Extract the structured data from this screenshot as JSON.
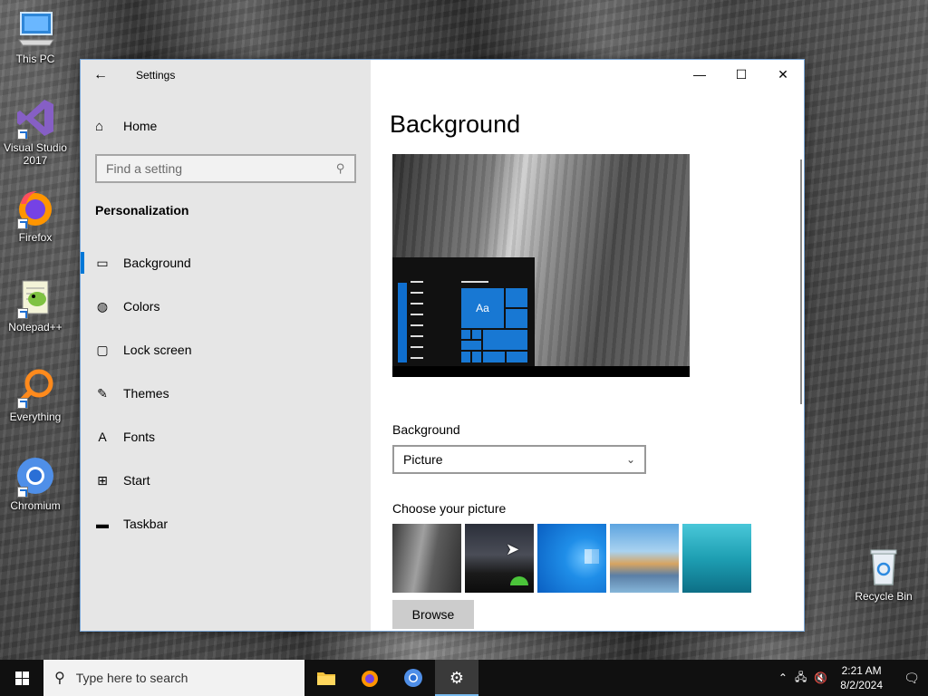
{
  "desktop": {
    "icons": [
      {
        "label": "This PC",
        "icon": "computer-icon"
      },
      {
        "label": "Visual Studio 2017",
        "icon": "visual-studio-icon"
      },
      {
        "label": "Firefox",
        "icon": "firefox-icon"
      },
      {
        "label": "Notepad++",
        "icon": "notepad-plus-plus-icon"
      },
      {
        "label": "Everything",
        "icon": "everything-search-icon"
      },
      {
        "label": "Chromium",
        "icon": "chromium-icon"
      },
      {
        "label": "Recycle Bin",
        "icon": "recycle-bin-icon"
      }
    ]
  },
  "window": {
    "app_title": "Settings",
    "caption": {
      "minimize": "—",
      "maximize": "☐",
      "close": "✕"
    },
    "nav": {
      "home_label": "Home",
      "search_placeholder": "Find a setting",
      "section_heading": "Personalization",
      "items": [
        {
          "label": "Background",
          "icon": "picture-icon",
          "selected": true
        },
        {
          "label": "Colors",
          "icon": "palette-icon",
          "selected": false
        },
        {
          "label": "Lock screen",
          "icon": "lock-screen-icon",
          "selected": false
        },
        {
          "label": "Themes",
          "icon": "themes-brush-icon",
          "selected": false
        },
        {
          "label": "Fonts",
          "icon": "fonts-icon",
          "selected": false
        },
        {
          "label": "Start",
          "icon": "start-icon",
          "selected": false
        },
        {
          "label": "Taskbar",
          "icon": "taskbar-icon",
          "selected": false
        }
      ]
    },
    "content": {
      "page_title": "Background",
      "preview_text": "Aa",
      "background_label": "Background",
      "background_value": "Picture",
      "choose_picture_label": "Choose your picture",
      "browse_label": "Browse"
    }
  },
  "taskbar": {
    "search_placeholder": "Type here to search",
    "pinned": [
      "file-explorer-icon",
      "firefox-icon",
      "chromium-icon",
      "settings-gear-icon"
    ],
    "clock": {
      "time": "2:21 AM",
      "date": "8/2/2024"
    }
  },
  "colors": {
    "accent": "#0078d7",
    "nav_bg": "#e6e6e6",
    "taskbar_bg": "#101010"
  }
}
